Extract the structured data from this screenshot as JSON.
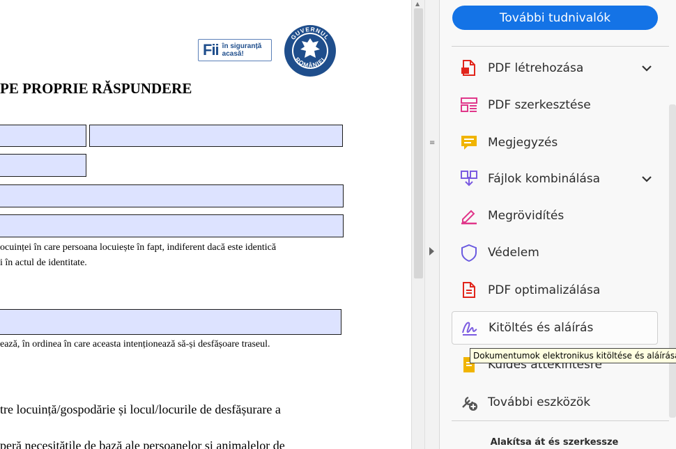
{
  "document": {
    "heading": "PE PROPRIE RĂSPUNDERE",
    "badge_big": "Fii",
    "badge_small_line1": "în siguranță",
    "badge_small_line2": "acasă!",
    "seal_top_text": "GUVERNUL",
    "seal_bottom_text": "ROMÂNIEI",
    "note1_line1": "ocuinței în care persoana locuiește în fapt, indiferent dacă este identică",
    "note1_line2": "i în actul de identitate.",
    "note2": "ează, în ordinea în care aceasta intenționează să-și desfășoare traseul.",
    "para1": "tre locuință/gospodărie și locul/locurile de desfășurare a",
    "para2": "peră necesitățile de bază ale persoanelor și animalelor de"
  },
  "tools_pane": {
    "more_info_button": "További tudnivalók",
    "tools": [
      {
        "label": "PDF létrehozása",
        "icon": "create-pdf-icon",
        "color": "#e1251b",
        "has_chevron": true
      },
      {
        "label": "PDF szerkesztése",
        "icon": "edit-pdf-icon",
        "color": "#e0368a",
        "has_chevron": false
      },
      {
        "label": "Megjegyzés",
        "icon": "comment-icon",
        "color": "#f0b400",
        "has_chevron": false
      },
      {
        "label": "Fájlok kombinálása",
        "icon": "combine-files-icon",
        "color": "#7a5ae0",
        "has_chevron": true
      },
      {
        "label": "Megrövidítés",
        "icon": "redact-icon",
        "color": "#e0368a",
        "has_chevron": false
      },
      {
        "label": "Védelem",
        "icon": "protect-icon",
        "color": "#6a5ae0",
        "has_chevron": false
      },
      {
        "label": "PDF optimalizálása",
        "icon": "optimize-pdf-icon",
        "color": "#e1251b",
        "has_chevron": false
      },
      {
        "label": "Kitöltés és aláírás",
        "icon": "fill-sign-icon",
        "color": "#7a5ae0",
        "has_chevron": false
      },
      {
        "label": "Küldés áttekintésre",
        "icon": "send-review-icon",
        "color": "#f0b400",
        "has_chevron": false
      },
      {
        "label": "További eszközök",
        "icon": "more-tools-icon",
        "color": "#555555",
        "has_chevron": false
      }
    ],
    "bottom_heading": "Alakítsa át és szerkessze"
  },
  "tooltip": "Dokumentumok elektronikus kitöltése és aláírása"
}
